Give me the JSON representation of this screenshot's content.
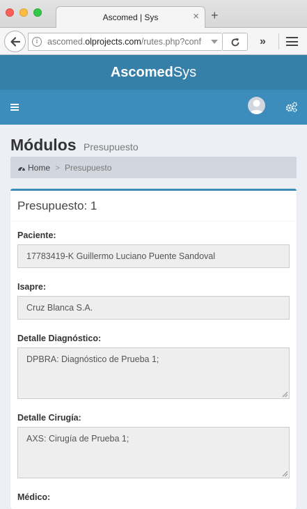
{
  "browser": {
    "tab_title": "Ascomed | Sys",
    "tab_close": "×",
    "new_tab": "+",
    "url_host_prefix": "ascomed.",
    "url_host": "olprojects.com",
    "url_path": "/rutes.php?conf",
    "overflow": "»"
  },
  "app": {
    "brand_bold": "Ascomed",
    "brand_light": "Sys"
  },
  "page": {
    "title": "Módulos",
    "subtitle": "Presupuesto"
  },
  "breadcrumb": {
    "home": "Home",
    "separator": ">",
    "current": "Presupuesto"
  },
  "form": {
    "box_title": "Presupuesto: 1",
    "fields": [
      {
        "label": "Paciente:",
        "value": "17783419-K Guillermo Luciano Puente Sandoval"
      },
      {
        "label": "Isapre:",
        "value": "Cruz Blanca S.A."
      },
      {
        "label": "Detalle Diagnóstico:",
        "value": "DPBRA: Diagnóstico de Prueba 1;"
      },
      {
        "label": "Detalle Cirugía:",
        "value": "AXS: Cirugía de Prueba 1;"
      },
      {
        "label": "Médico:",
        "value": ""
      }
    ]
  },
  "colors": {
    "brand_bar": "#367fa9",
    "nav_bar": "#3c8dbc",
    "content_bg": "#ecf0f5",
    "breadcrumb_bg": "#d2d6de"
  }
}
